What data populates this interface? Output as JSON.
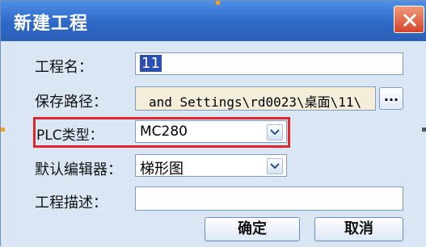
{
  "window": {
    "title": "新建工程"
  },
  "form": {
    "project_name_label": "工程名：",
    "project_name_value": "11",
    "save_path_label": "保存路径：",
    "save_path_value": "and Settings\\rd0023\\桌面\\11\\",
    "browse_label": "...",
    "plc_type_label": "PLC类型：",
    "plc_type_value": "MC280",
    "default_editor_label": "默认编辑器：",
    "default_editor_value": "梯形图",
    "description_label": "工程描述：",
    "description_value": ""
  },
  "buttons": {
    "ok_label": "确定",
    "cancel_label": "取消"
  },
  "colors": {
    "title_bar": "#2e68c6",
    "highlight": "#e0262b",
    "close_button": "#d4452b"
  }
}
